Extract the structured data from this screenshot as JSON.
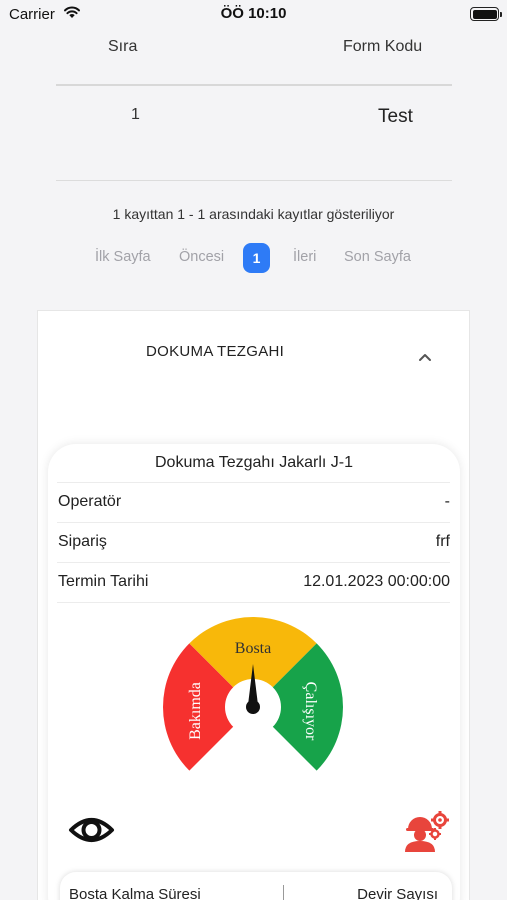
{
  "status_bar": {
    "carrier": "Carrier",
    "time": "ÖÖ 10:10"
  },
  "table": {
    "headers": [
      "Sıra",
      "Form Kodu"
    ],
    "rows": [
      {
        "sira": "1",
        "form_kodu": "Test"
      }
    ]
  },
  "pagination": {
    "info": "1 kayıttan 1 - 1 arasındaki kayıtlar gösteriliyor",
    "first": "İlk Sayfa",
    "prev": "Öncesi",
    "current": "1",
    "next": "İleri",
    "last": "Son Sayfa"
  },
  "panel": {
    "title": "DOKUMA TEZGAHI"
  },
  "machine_card": {
    "title": "Dokuma Tezgahı Jakarlı J-1",
    "rows": [
      {
        "label": "Operatör",
        "value": "-"
      },
      {
        "label": "Sipariş",
        "value": "frf"
      },
      {
        "label": "Termin Tarihi",
        "value": "12.01.2023 00:00:00"
      }
    ],
    "gauge": {
      "segments": [
        {
          "label": "Bakımda",
          "color": "#f6312f"
        },
        {
          "label": "Bosta",
          "color": "#f8b80a"
        },
        {
          "label": "Çalışıyor",
          "color": "#17a34a"
        }
      ],
      "current": "Bosta"
    },
    "icons": {
      "left": "eye-icon",
      "right": "worker-settings-icon",
      "right_color": "#e8453c"
    },
    "stats": {
      "left": "Bosta Kalma Süresi",
      "right": "Devir Sayısı"
    }
  }
}
